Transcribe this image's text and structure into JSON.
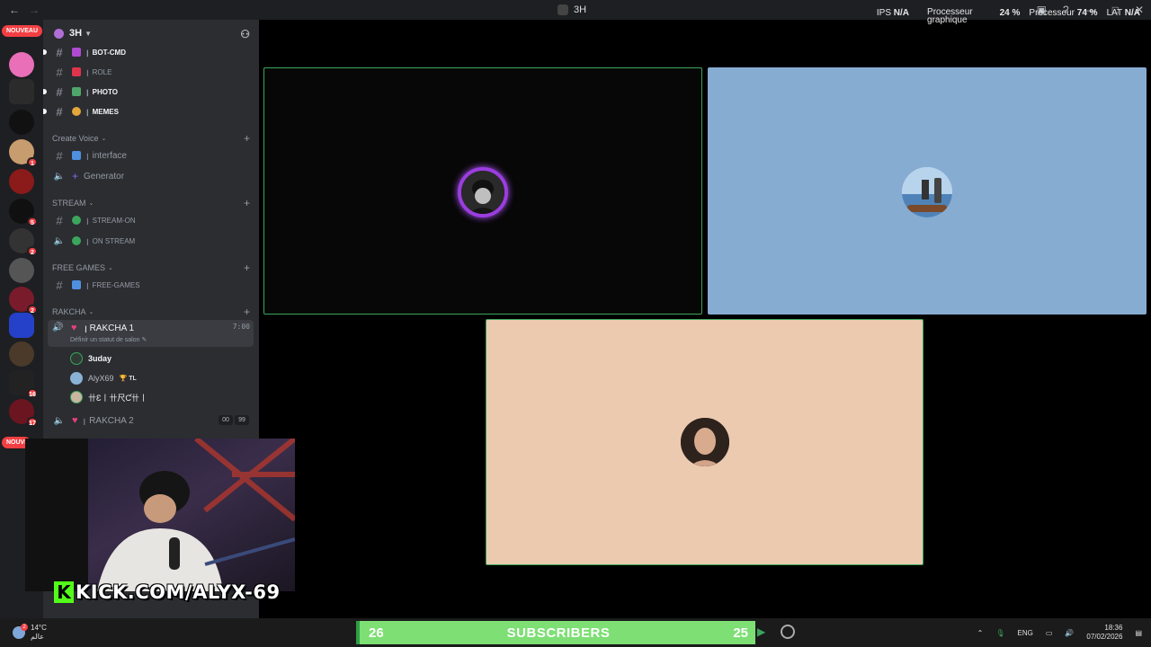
{
  "window": {
    "title": "3H"
  },
  "stats": {
    "ips_label": "IPS",
    "ips_value": "N/A",
    "gpu_label_1": "Processeur",
    "gpu_label_2": "graphique",
    "gpu_value": "24 %",
    "cpu_label": "Processeur",
    "cpu_value": "74 %",
    "lat_label": "LAT",
    "lat_value": "N/A"
  },
  "servers": {
    "new_label": "NOUVEAU",
    "new_label_2": "NOUVI",
    "badges": [
      "1",
      "5",
      "2",
      "2",
      "16",
      "17"
    ]
  },
  "sidebar": {
    "server_name": "3H",
    "channels_top": [
      {
        "name": "BOT-CMD",
        "sep": "ꞁ"
      },
      {
        "name": "ROLE",
        "sep": "ꞁ"
      },
      {
        "name": "PHOTO",
        "sep": "ꞁ"
      },
      {
        "name": "MEMES",
        "sep": "ꞁ"
      }
    ],
    "cat_create_voice": "Create Voice",
    "ch_interface": "interface",
    "ch_generator": "Generator",
    "cat_stream": "STREAM",
    "ch_stream_on": "STREAM-ON",
    "ch_on_stream": "ON STREAM",
    "cat_free_games": "FREE GAMES",
    "ch_free_games": "FREE-GAMES",
    "cat_rakcha": "RAKCHA",
    "voice_1": {
      "name": "RAKCHA 1",
      "time": "7:00",
      "status": "Définir un statut de salon"
    },
    "voice_users": [
      {
        "name": "3uday"
      },
      {
        "name": "AlyX69",
        "tag": "TL"
      },
      {
        "name": "卄Ɛ丨卄尺Ƈ卄丨"
      }
    ],
    "voice_2": {
      "name": "RAKCHA 2",
      "count_a": "00",
      "count_b": "99"
    },
    "sep": "ꞁ"
  },
  "overlay": {
    "kick_url": "KICK.COM/ALYX-69",
    "kick_k": "K"
  },
  "taskbar": {
    "temp": "14°C",
    "weather_text": "عالم",
    "weather_badge": "2",
    "sub_left": "26",
    "sub_label": "SUBSCRIBERS",
    "sub_right": "25",
    "lang": "ENG",
    "time": "18:36",
    "date": "07/02/2026"
  },
  "colors": {
    "speaking_border": "#3ba55c",
    "tile_blue": "#87acd2",
    "tile_peach": "#ebcab0",
    "sub_bar": "#7ddf74"
  }
}
